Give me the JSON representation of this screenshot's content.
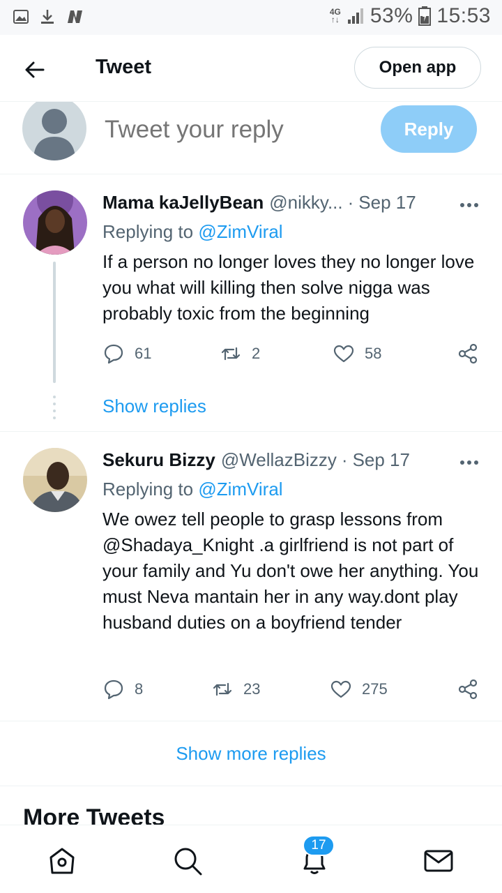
{
  "status_bar": {
    "network_top": "4G",
    "network_bottom": "↑↓",
    "battery": "53%",
    "time": "15:53"
  },
  "header": {
    "title": "Tweet",
    "open_app_label": "Open app"
  },
  "composer": {
    "placeholder": "Tweet your reply",
    "reply_label": "Reply"
  },
  "tweets": [
    {
      "name": "Mama kaJellyBean",
      "handle": "@nikky...",
      "separator": "·",
      "date": "Sep 17",
      "replying_prefix": "Replying to",
      "replying_to": "@ZimViral",
      "text": "If a person no longer loves they no longer love you what will killing then solve nigga was probably toxic from the beginning",
      "replies": "61",
      "retweets": "2",
      "likes": "58",
      "show_replies": "Show replies",
      "avatar_color": "#7a4fa0"
    },
    {
      "name": "Sekuru Bizzy",
      "handle": "@WellazBizzy",
      "separator": "·",
      "date": "Sep 17",
      "replying_prefix": "Replying to",
      "replying_to": "@ZimViral",
      "text": "We owez tell people to grasp lessons from @Shadaya_Knight .a girlfriend is not part of your family and Yu don't owe her anything. You must Neva mantain her in any way.dont play husband duties on a boyfriend tender",
      "replies": "8",
      "retweets": "23",
      "likes": "275",
      "avatar_color": "#b89a6a"
    }
  ],
  "show_more_replies": "Show more replies",
  "more_tweets_heading": "More Tweets",
  "bottom_nav": {
    "notifications_badge": "17"
  },
  "colors": {
    "accent": "#1d9bf0",
    "reply_button": "#8ecdf8",
    "secondary_text": "#536471"
  }
}
